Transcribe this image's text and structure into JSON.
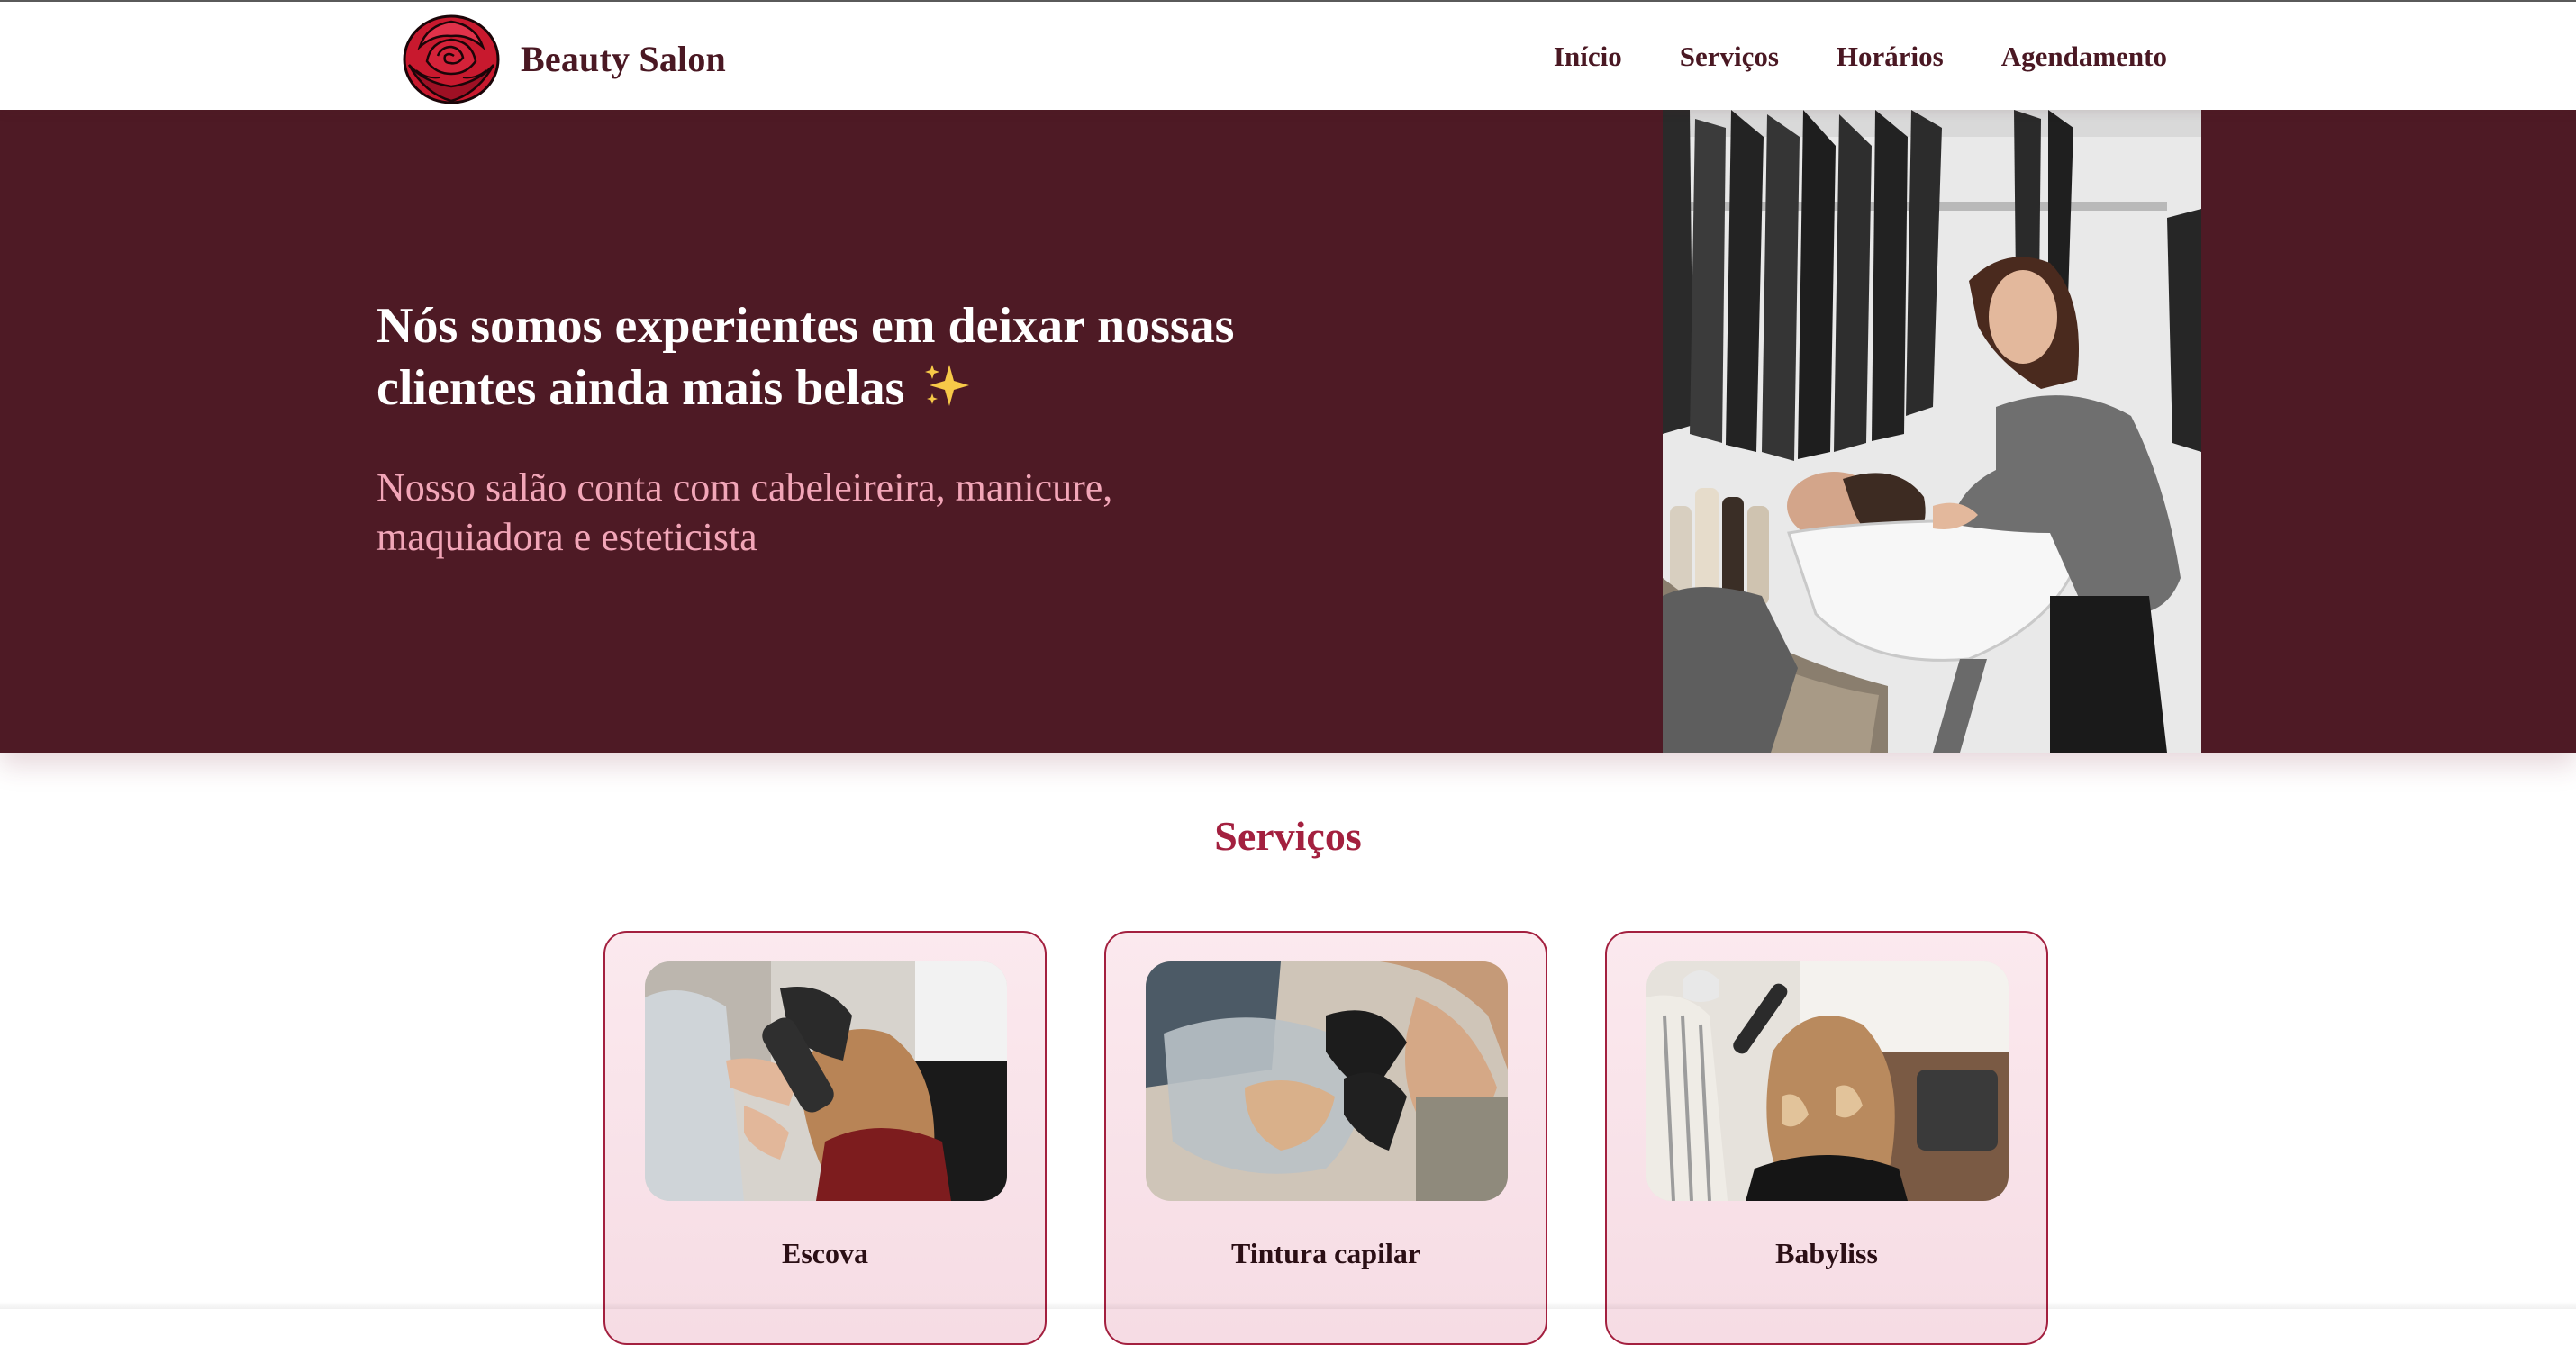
{
  "header": {
    "brand": "Beauty Salon",
    "nav": [
      "Início",
      "Serviços",
      "Horários",
      "Agendamento"
    ]
  },
  "hero": {
    "title": "Nós somos experientes em deixar nossas clientes ainda mais belas",
    "subtitle": "Nosso salão conta com cabeleireira, manicure, maquiadora e esteticista"
  },
  "services": {
    "title": "Serviços",
    "cards": [
      {
        "name": "Escova"
      },
      {
        "name": "Tintura capilar"
      },
      {
        "name": "Babyliss"
      }
    ]
  },
  "colors": {
    "primary": "#4e1a25",
    "accent": "#a3203f",
    "subtitle": "#f2a6b8",
    "card_bg": "#fbe9ee"
  },
  "icons": [
    "rose-logo-icon",
    "sparkles-icon"
  ]
}
